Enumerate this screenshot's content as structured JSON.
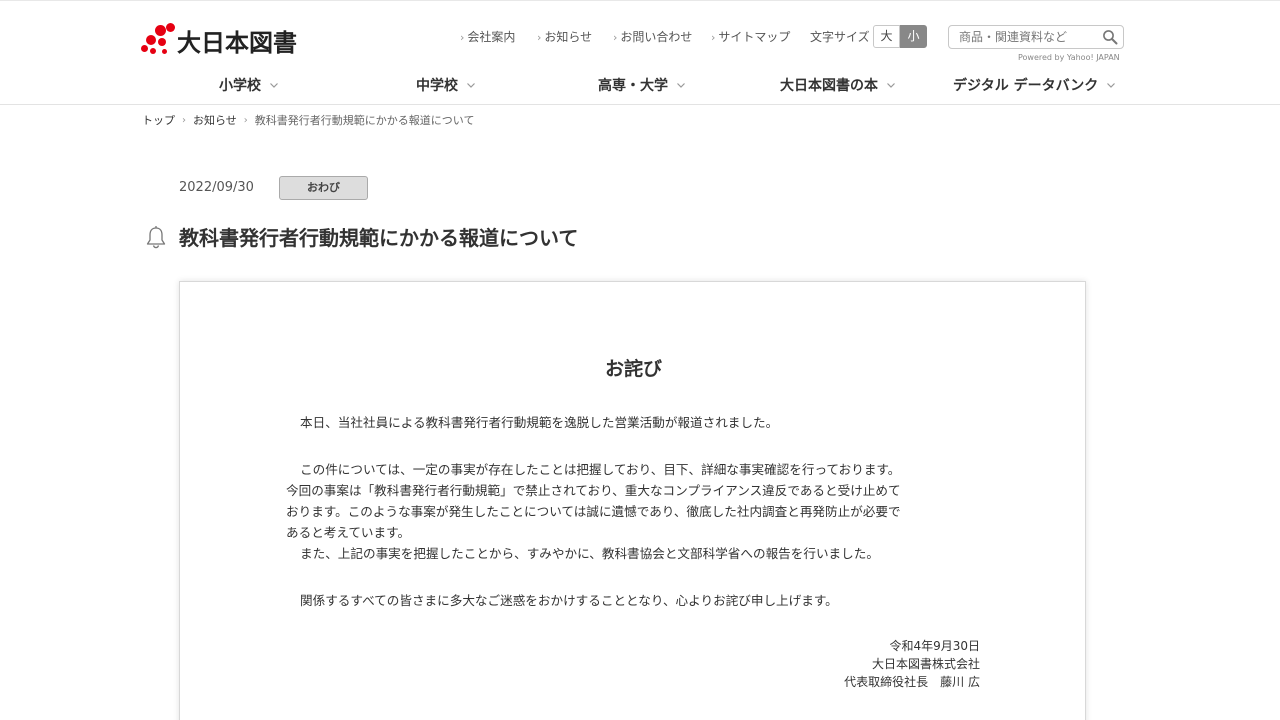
{
  "header": {
    "logo_text": "大日本図書",
    "utility_links": [
      "会社案内",
      "お知らせ",
      "お問い合わせ",
      "サイトマップ"
    ],
    "font_size": {
      "label": "文字サイズ",
      "large": "大",
      "small": "小",
      "selected": "小"
    },
    "search": {
      "placeholder": "商品・関連資料など",
      "value": ""
    },
    "powered_by": "Powered by Yahoo! JAPAN"
  },
  "nav": {
    "items": [
      "小学校",
      "中学校",
      "高専・大学",
      "大日本図書の本",
      "デジタル データバンク"
    ]
  },
  "breadcrumb": {
    "items": [
      "トップ",
      "お知らせ",
      "教科書発行者行動規範にかかる報道について"
    ]
  },
  "article": {
    "date": "2022/09/30",
    "category": "おわび",
    "title": "教科書発行者行動規範にかかる報道について"
  },
  "notice": {
    "heading": "お詫び",
    "paragraph1": "本日、当社社員による教科書発行者行動規範を逸脱した営業活動が報道されました。",
    "paragraph2_lines": [
      "この件については、一定の事実が存在したことは把握しており、目下、詳細な事実確認を行っております。",
      "今回の事案は「教科書発行者行動規範」で禁止されており、重大なコンプライアンス違反であると受け止めて",
      "おります。このような事案が発生したことについては誠に遺憾であり、徹底した社内調査と再発防止が必要で",
      "あると考えています。",
      "また、上記の事実を把握したことから、すみやかに、教科書協会と文部科学省への報告を行いました。"
    ],
    "paragraph3": "関係するすべての皆さまに多大なご迷惑をおかけすることとなり、心よりお詫び申し上げます。",
    "signature": {
      "date": "令和4年9月30日",
      "company": "大日本図書株式会社",
      "representative": "代表取締役社長　藤川 広"
    }
  },
  "colors": {
    "brand": "#e60012",
    "text": "#333333",
    "badge_bg": "#dddddd",
    "font_size_selected": "#888888"
  },
  "icons": [
    "logo-mark-icon",
    "chevron-right-icon",
    "search-icon",
    "chevron-down-icon",
    "bell-icon"
  ]
}
